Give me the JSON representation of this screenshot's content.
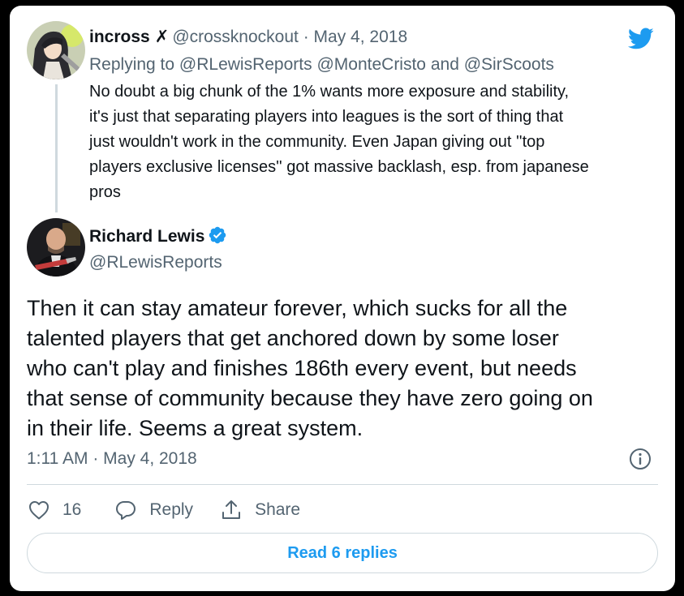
{
  "parent_tweet": {
    "author_name": "incross",
    "author_glyph": "✗",
    "author_handle": "@crossknockout",
    "separator": "·",
    "date": "May 4, 2018",
    "replying_prefix": "Replying to",
    "replying_to_1": "@RLewisReports",
    "replying_to_2": "@MonteCristo",
    "replying_and": "and",
    "replying_to_3": "@SirScoots",
    "text": "No doubt a big chunk of the 1% wants more exposure and stability,\nit's just that separating players into leagues is the sort of thing that\njust wouldn't work in the community. Even Japan giving out ''top\nplayers exclusive licenses'' got massive backlash, esp. from japanese\npros"
  },
  "main_tweet": {
    "author_name": "Richard Lewis",
    "author_handle": "@RLewisReports",
    "text": "Then it can stay amateur forever, which sucks for all the\ntalented players that get anchored down by some loser\nwho can't play and finishes 186th every event, but needs\nthat sense of community because they have zero going on\nin their life. Seems a great system.",
    "timestamp": "1:11 AM · May 4, 2018"
  },
  "actions": {
    "like_count": "16",
    "reply_label": "Reply",
    "share_label": "Share"
  },
  "read_replies_label": "Read 6 replies",
  "icons": {
    "brand": "twitter-bird-icon",
    "verified": "verified-badge-icon",
    "info": "info-icon",
    "like": "heart-icon",
    "reply": "speech-bubble-icon",
    "share": "share-upload-icon"
  },
  "colors": {
    "brand_blue": "#1d9bf0",
    "text_primary": "#0f1419",
    "text_secondary": "#536471",
    "border": "#cfd9de",
    "page_background": "#000000",
    "card_background": "#ffffff"
  }
}
